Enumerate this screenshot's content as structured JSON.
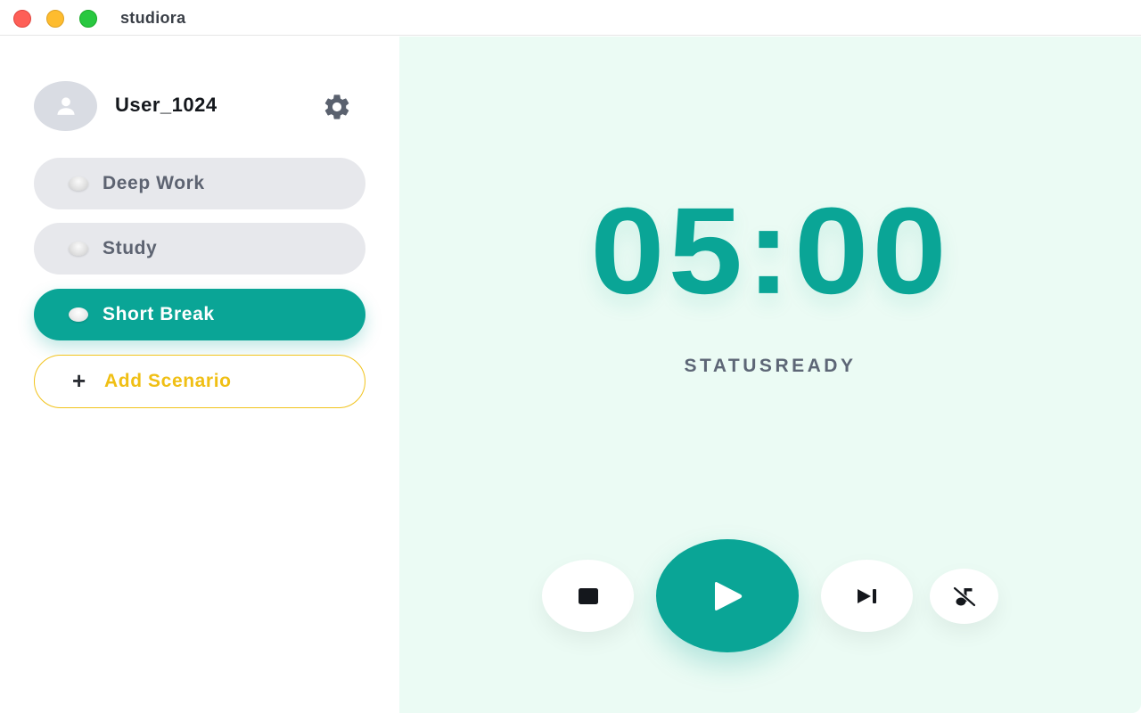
{
  "window": {
    "title": "studiora"
  },
  "sidebar": {
    "user": {
      "name": "User_1024",
      "avatar_icon": "user-icon",
      "settings_icon": "gear-icon"
    },
    "scenarios": [
      {
        "label": "Deep Work",
        "active": false
      },
      {
        "label": "Study",
        "active": false
      },
      {
        "label": "Short Break",
        "active": true
      }
    ],
    "add_scenario": {
      "icon": "plus",
      "label": "Add Scenario"
    }
  },
  "main": {
    "timer": "05:00",
    "status": {
      "prefix": "STATUS",
      "value": "READY"
    },
    "controls": {
      "stop_icon": "stop-icon",
      "play_icon": "play-icon",
      "skip_icon": "skip-next-icon",
      "music_icon": "music-off-icon"
    }
  },
  "colors": {
    "accent": "#0aa596",
    "accent_secondary": "#f0bf14",
    "main_background": "#ebfbf4",
    "pill_inactive": "#e7e8ec"
  }
}
